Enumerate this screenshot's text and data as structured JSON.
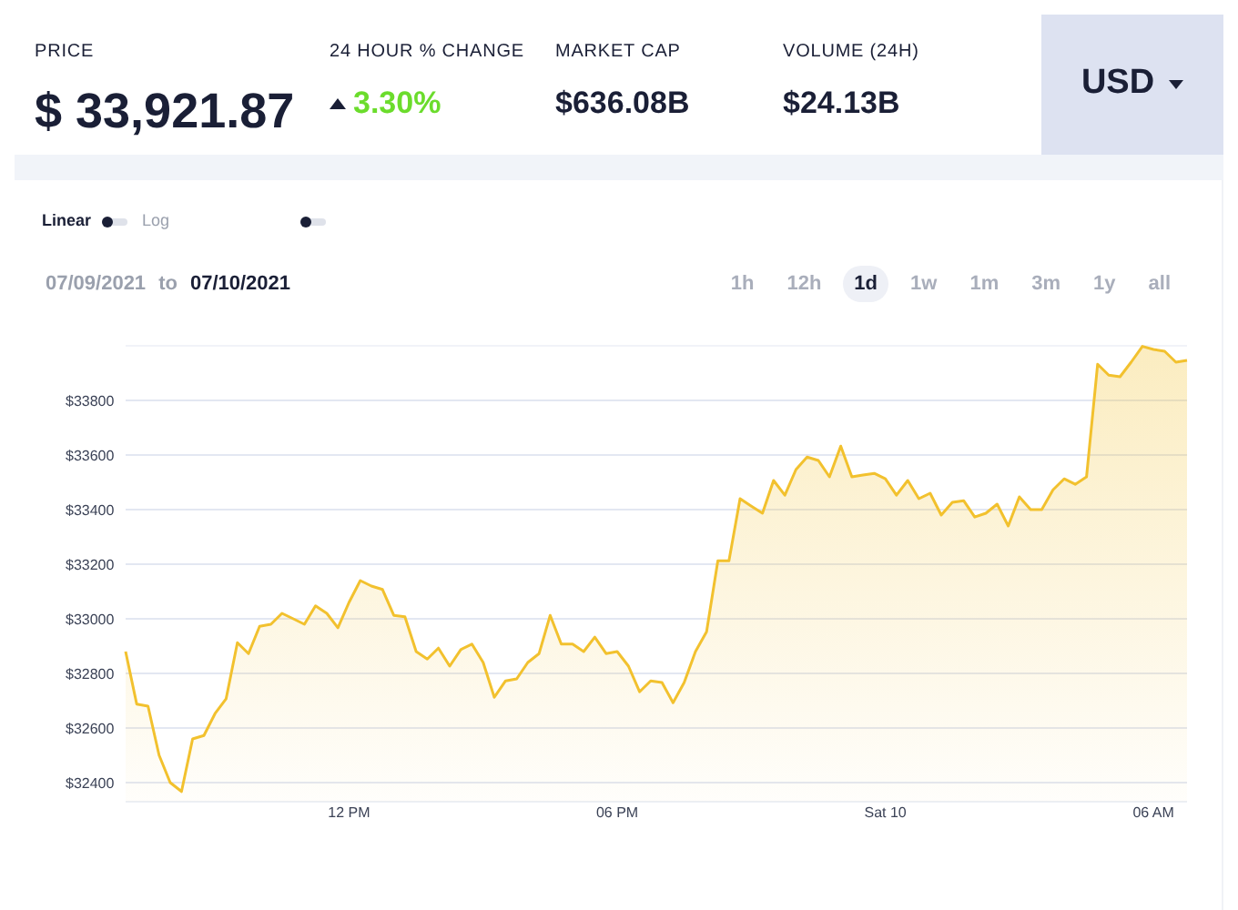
{
  "stats": [
    {
      "label": "PRICE",
      "value": "$ 33,921.87",
      "kind": "price"
    },
    {
      "label": "24 HOUR % CHANGE",
      "value": "3.30%",
      "kind": "change"
    },
    {
      "label": "MARKET CAP",
      "value": "$636.08B",
      "kind": "plain"
    },
    {
      "label": "VOLUME (24H)",
      "value": "$24.13B",
      "kind": "plain"
    }
  ],
  "currency": {
    "label": "USD"
  },
  "scale_options": [
    {
      "label": "Linear",
      "selected": true
    },
    {
      "label": "Log",
      "selected": false
    }
  ],
  "extra_toggle": {
    "on": false
  },
  "date_range": {
    "from": "07/09/2021",
    "separator": "to",
    "to": "07/10/2021"
  },
  "ranges": [
    {
      "label": "1h",
      "selected": false
    },
    {
      "label": "12h",
      "selected": false
    },
    {
      "label": "1d",
      "selected": true
    },
    {
      "label": "1w",
      "selected": false
    },
    {
      "label": "1m",
      "selected": false
    },
    {
      "label": "3m",
      "selected": false
    },
    {
      "label": "1y",
      "selected": false
    },
    {
      "label": "all",
      "selected": false
    }
  ],
  "chart": {
    "chart_data": {
      "type": "area",
      "grid": true,
      "ylim": [
        32330,
        34000
      ],
      "yticks": [
        {
          "value": 32400,
          "label": "$32400"
        },
        {
          "value": 32600,
          "label": "$32600"
        },
        {
          "value": 32800,
          "label": "$32800"
        },
        {
          "value": 33000,
          "label": "$33000"
        },
        {
          "value": 33200,
          "label": "$33200"
        },
        {
          "value": 33400,
          "label": "$33400"
        },
        {
          "value": 33600,
          "label": "$33600"
        },
        {
          "value": 33800,
          "label": "$33800"
        }
      ],
      "series": [
        {
          "color": "#f2c12e",
          "values": [
            32880,
            32687,
            32680,
            32500,
            32400,
            32367,
            32560,
            32573,
            32653,
            32707,
            32913,
            32873,
            32973,
            32980,
            33020,
            33000,
            32980,
            33047,
            33020,
            32967,
            33060,
            33140,
            33120,
            33107,
            33013,
            33007,
            32880,
            32853,
            32893,
            32827,
            32887,
            32907,
            32840,
            32713,
            32773,
            32780,
            32840,
            32873,
            33013,
            32907,
            32907,
            32880,
            32933,
            32873,
            32880,
            32827,
            32733,
            32773,
            32767,
            32693,
            32767,
            32880,
            32953,
            33213,
            33213,
            33440,
            33413,
            33387,
            33507,
            33453,
            33547,
            33593,
            33580,
            33520,
            33633,
            33520,
            33527,
            33533,
            33513,
            33453,
            33507,
            33440,
            33460,
            33380,
            33427,
            33433,
            33373,
            33387,
            33420,
            33340,
            33447,
            33400,
            33400,
            33473,
            33513,
            33493,
            33520,
            33933,
            33893,
            33887,
            33940,
            33998,
            33987,
            33980,
            33940,
            33947
          ]
        }
      ]
    },
    "x_axis_labels": [
      "12 PM",
      "06 PM",
      "Sat 10",
      "06 AM"
    ]
  }
}
